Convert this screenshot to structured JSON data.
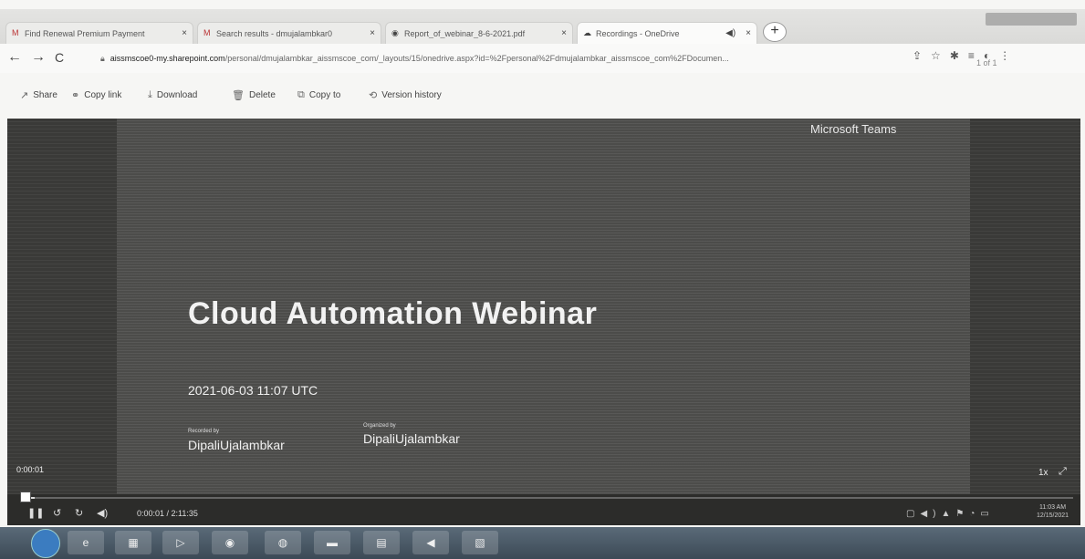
{
  "browser": {
    "tabs": [
      {
        "label": "Find Renewal Premium Payment",
        "icon": "gmail-icon",
        "active": false
      },
      {
        "label": "Search results - dmujalambkar0",
        "icon": "gmail-icon",
        "active": false
      },
      {
        "label": "Report_of_webinar_8-6-2021.pdf",
        "icon": "chrome-icon",
        "active": false
      },
      {
        "label": "Recordings - OneDrive",
        "icon": "onedrive-icon",
        "active": true
      }
    ],
    "url_host": "aissmscoe0-my.sharepoint.com",
    "url_path": "/personal/dmujalambkar_aissmscoe_com/_layouts/15/onedrive.aspx?id=%2Fpersonal%2Fdmujalambkar_aissmscoe_com%2FDocumen...",
    "pager": "1 of 1"
  },
  "commands": {
    "share": "Share",
    "copy_link": "Copy link",
    "download": "Download",
    "delete": "Delete",
    "copy_to": "Copy to",
    "version_history": "Version history"
  },
  "slide": {
    "brand": "Microsoft Teams",
    "title": "Cloud Automation Webinar",
    "date": "2021-06-03 11:07 UTC",
    "recorded_by_label": "Recorded by",
    "recorded_by": "DipaliUjalambkar",
    "organized_by_label": "Organized by",
    "organized_by": "DipaliUjalambkar"
  },
  "player": {
    "time_overlay": "0:00:01",
    "time_readout": "0:00:01 / 2:11:35",
    "speed": "1x",
    "progress_fraction": 0.01
  },
  "taskbar": {
    "clock_time": "11:03 AM",
    "clock_date": "12/15/2021"
  }
}
